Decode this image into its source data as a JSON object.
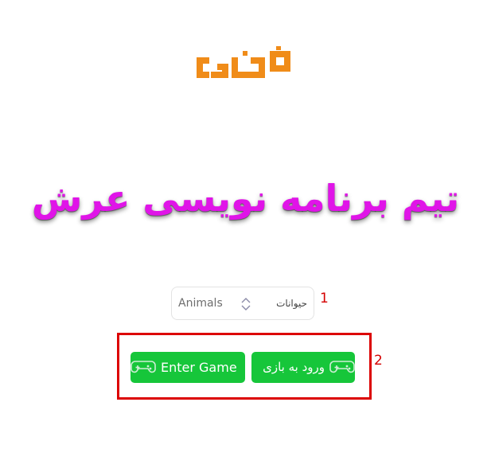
{
  "logo": {
    "text": "فن آورد",
    "color": "#f08c19"
  },
  "hero": {
    "title": "تیم برنامه نویسی عرش",
    "color": "#e014e8"
  },
  "category_select": {
    "selected_en": "Animals",
    "selected_fa": "حیوانات",
    "marker": "1"
  },
  "buttons": {
    "enter_game_en": "Enter Game",
    "enter_game_fa": "ورود به بازی",
    "marker": "2",
    "color": "#16c63a"
  },
  "icons": {
    "controller": "gamepad-icon",
    "chevron": "chevron-updown-icon"
  }
}
